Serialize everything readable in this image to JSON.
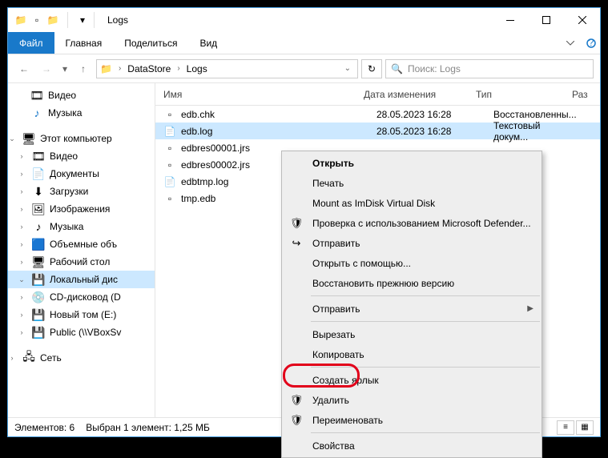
{
  "window": {
    "title": "Logs"
  },
  "ribbon": {
    "file": "Файл",
    "tabs": [
      "Главная",
      "Поделиться",
      "Вид"
    ]
  },
  "breadcrumb": {
    "items": [
      "DataStore",
      "Logs"
    ]
  },
  "search": {
    "placeholder": "Поиск: Logs"
  },
  "sidebar": {
    "items": [
      {
        "label": "Видео",
        "icon": "🎞"
      },
      {
        "label": "Музыка",
        "icon": "♪"
      }
    ],
    "pc": {
      "label": "Этот компьютер"
    },
    "pc_items": [
      {
        "label": "Видео",
        "icon": "🎞"
      },
      {
        "label": "Документы",
        "icon": "📄"
      },
      {
        "label": "Загрузки",
        "icon": "⬇"
      },
      {
        "label": "Изображения",
        "icon": "🖼"
      },
      {
        "label": "Музыка",
        "icon": "♪"
      },
      {
        "label": "Объемные объ",
        "icon": "🟦"
      },
      {
        "label": "Рабочий стол",
        "icon": "🖥"
      },
      {
        "label": "Локальный дис",
        "icon": "💾",
        "sel": true
      },
      {
        "label": "CD-дисковод (D",
        "icon": "💿"
      },
      {
        "label": "Новый том (E:)",
        "icon": "💾"
      },
      {
        "label": "Public (\\\\VBoxSv",
        "icon": "💾"
      }
    ],
    "net": {
      "label": "Сеть"
    }
  },
  "columns": {
    "name": "Имя",
    "date": "Дата изменения",
    "type": "Тип",
    "size": "Раз"
  },
  "files": [
    {
      "name": "edb.chk",
      "date": "28.05.2023 16:28",
      "type": "Восстановленны...",
      "icon": "▫"
    },
    {
      "name": "edb.log",
      "date": "28.05.2023 16:28",
      "type": "Текстовый докум...",
      "icon": "📄",
      "sel": true
    },
    {
      "name": "edbres00001.jrs",
      "date": "",
      "type": "",
      "icon": "▫"
    },
    {
      "name": "edbres00002.jrs",
      "date": "",
      "type": "",
      "icon": "▫"
    },
    {
      "name": "edbtmp.log",
      "date": "",
      "type": "",
      "icon": "📄"
    },
    {
      "name": "tmp.edb",
      "date": "",
      "type": "",
      "icon": "▫"
    }
  ],
  "status": {
    "count": "Элементов: 6",
    "selected": "Выбран 1 элемент: 1,25 МБ"
  },
  "context": {
    "open": "Открыть",
    "print": "Печать",
    "mount": "Mount as ImDisk Virtual Disk",
    "defender": "Проверка с использованием Microsoft Defender...",
    "share": "Отправить",
    "openwith": "Открыть с помощью...",
    "restore": "Восстановить прежнюю версию",
    "sendto": "Отправить",
    "cut": "Вырезать",
    "copy": "Копировать",
    "shortcut": "Создать ярлык",
    "delete": "Удалить",
    "rename": "Переименовать",
    "props": "Свойства"
  }
}
